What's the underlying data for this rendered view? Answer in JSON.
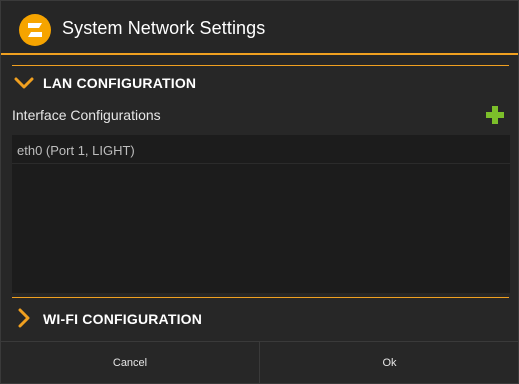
{
  "dialog": {
    "title": "System Network Settings",
    "app_icon": "app-logo-icon"
  },
  "lan": {
    "title": "LAN CONFIGURATION",
    "expanded": true,
    "interfaces_label": "Interface Configurations",
    "add_icon": "plus-icon",
    "interfaces": [
      {
        "label": "eth0 (Port 1, LIGHT)"
      }
    ]
  },
  "wifi": {
    "title": "WI-FI CONFIGURATION",
    "expanded": false
  },
  "footer": {
    "cancel_label": "Cancel",
    "ok_label": "Ok"
  },
  "colors": {
    "accent": "#f0a020",
    "add_green": "#7cbf2a",
    "background": "#272727"
  }
}
